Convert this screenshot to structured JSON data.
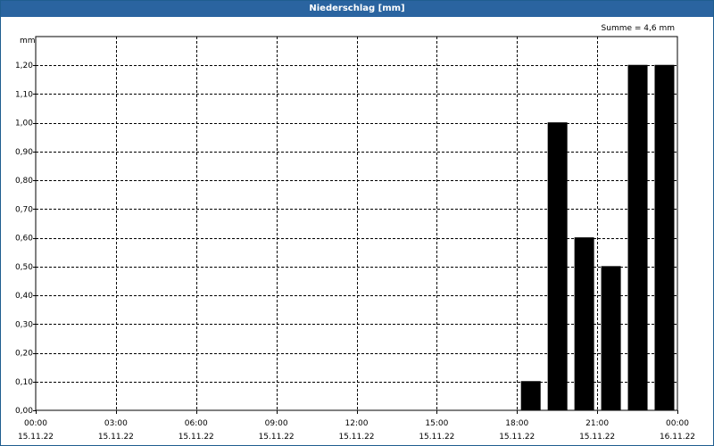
{
  "window": {
    "title": "Niederschlag [mm]"
  },
  "chart_data": {
    "type": "bar",
    "title": "Niederschlag [mm]",
    "ylabel": "mm",
    "sum_label": "Summe = 4,6 mm",
    "ylim": [
      0,
      1.3
    ],
    "yticks": [
      0.0,
      0.1,
      0.2,
      0.3,
      0.4,
      0.5,
      0.6,
      0.7,
      0.8,
      0.9,
      1.0,
      1.1,
      1.2
    ],
    "ytick_labels": [
      "0,00",
      "0,10",
      "0,20",
      "0,30",
      "0,40",
      "0,50",
      "0,60",
      "0,70",
      "0,80",
      "0,90",
      "1,00",
      "1,10",
      "1,20"
    ],
    "x_range_hours": [
      0,
      24
    ],
    "xtick_hours": [
      0,
      3,
      6,
      9,
      12,
      15,
      18,
      21,
      24
    ],
    "xtick_labels": [
      {
        "time": "00:00",
        "date": "15.11.22"
      },
      {
        "time": "03:00",
        "date": "15.11.22"
      },
      {
        "time": "06:00",
        "date": "15.11.22"
      },
      {
        "time": "09:00",
        "date": "15.11.22"
      },
      {
        "time": "12:00",
        "date": "15.11.22"
      },
      {
        "time": "15:00",
        "date": "15.11.22"
      },
      {
        "time": "18:00",
        "date": "15.11.22"
      },
      {
        "time": "21:00",
        "date": "15.11.22"
      },
      {
        "time": "00:00",
        "date": "16.11.22"
      }
    ],
    "bars": [
      {
        "hour": 19,
        "value": 0.1
      },
      {
        "hour": 20,
        "value": 1.0
      },
      {
        "hour": 21,
        "value": 0.6
      },
      {
        "hour": 22,
        "value": 0.5
      },
      {
        "hour": 23,
        "value": 1.2
      },
      {
        "hour": 24,
        "value": 1.2
      }
    ],
    "grid": true,
    "colors": {
      "bar": "#000000",
      "grid": "#000000",
      "titlebar": "#2a64a0"
    }
  }
}
